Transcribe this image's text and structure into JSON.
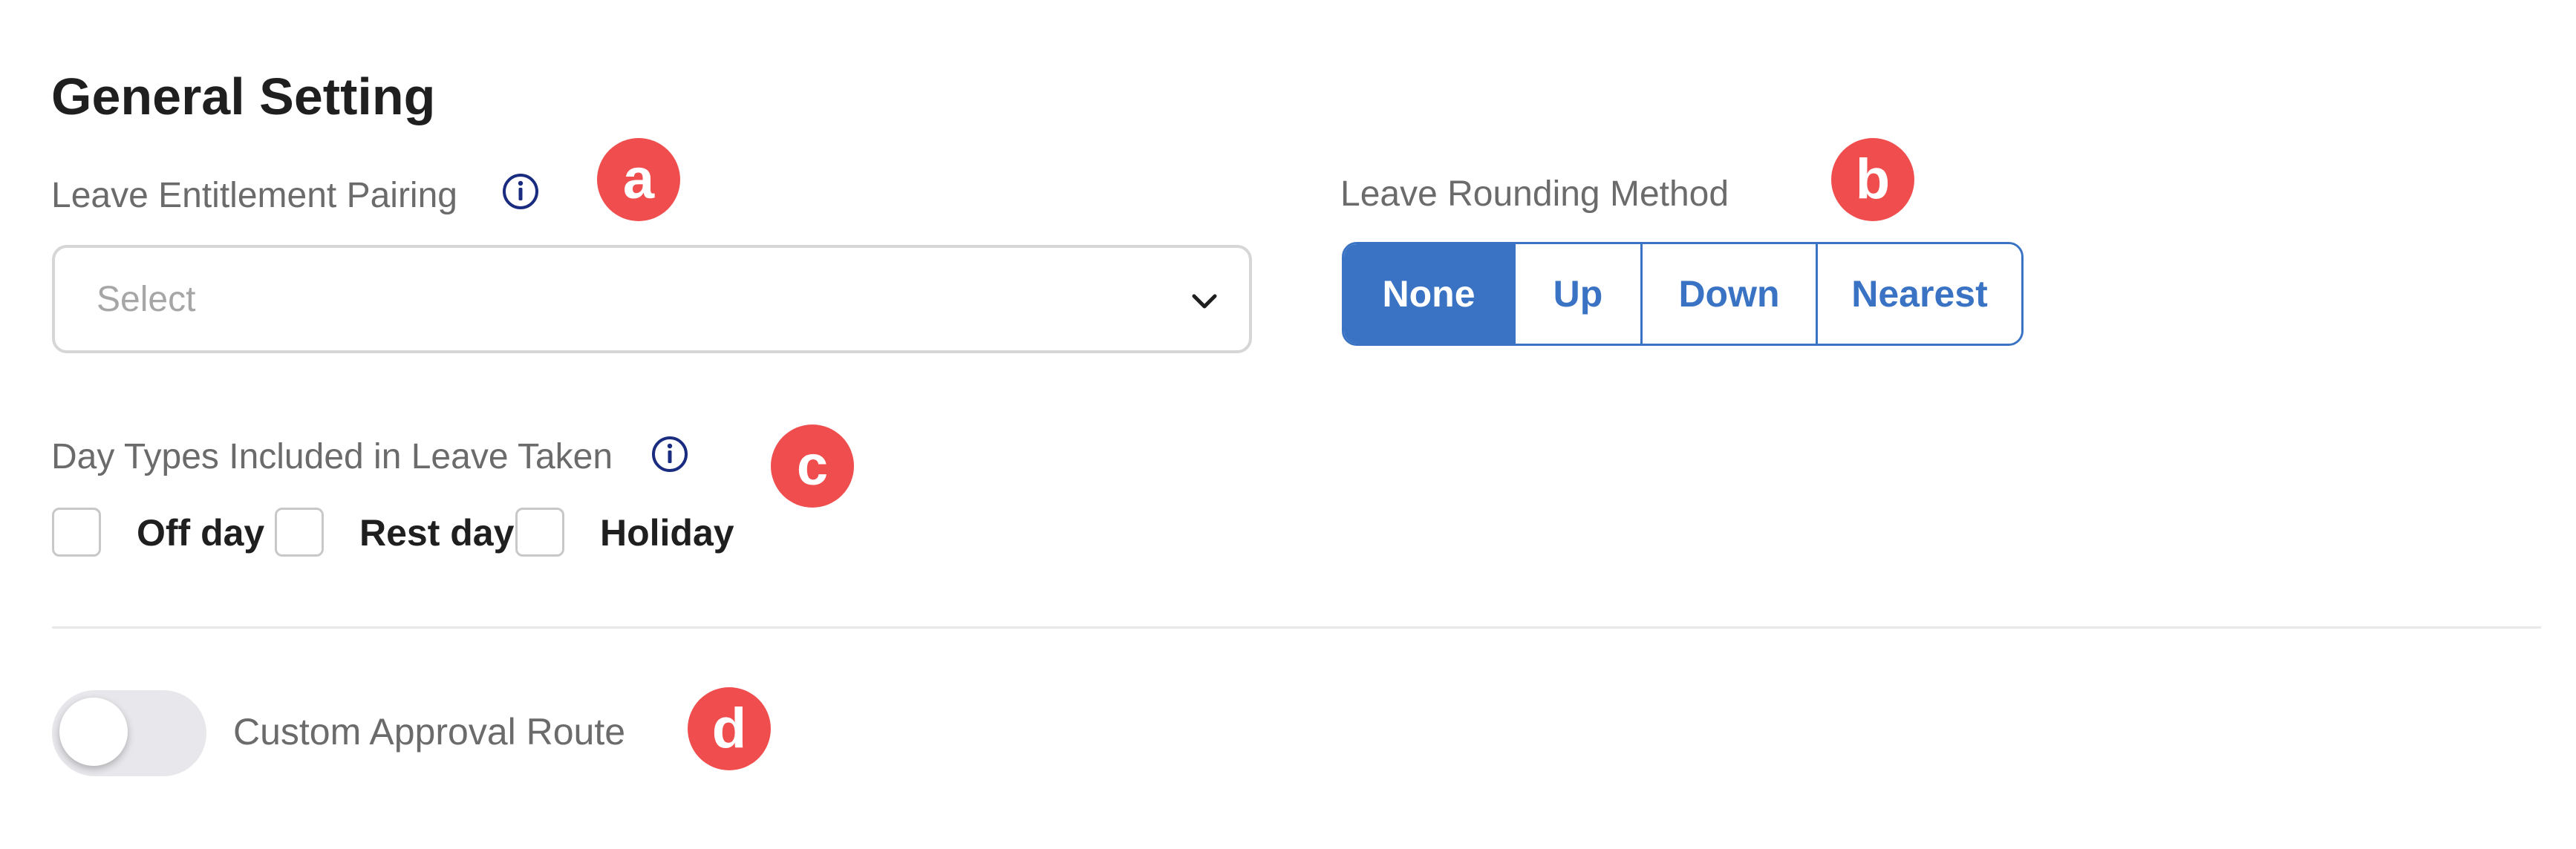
{
  "page_title": "General Setting",
  "leave_entitlement": {
    "label": "Leave Entitlement Pairing",
    "info_icon": "info-icon",
    "select_placeholder": "Select",
    "callout": "a"
  },
  "leave_rounding": {
    "label": "Leave Rounding Method",
    "callout": "b",
    "options": [
      "None",
      "Up",
      "Down",
      "Nearest"
    ],
    "selected": "None"
  },
  "day_types": {
    "label": "Day Types Included in Leave Taken",
    "info_icon": "info-icon",
    "callout": "c",
    "options": [
      {
        "label": "Off day",
        "checked": false
      },
      {
        "label": "Rest day",
        "checked": false
      },
      {
        "label": "Holiday",
        "checked": false
      }
    ]
  },
  "approval": {
    "toggle_label": "Custom Approval Route",
    "enabled": false,
    "callout": "d"
  },
  "colors": {
    "primary": "#3a73c4",
    "callout": "#f04e4e",
    "info_icon": "#1a2c80"
  }
}
